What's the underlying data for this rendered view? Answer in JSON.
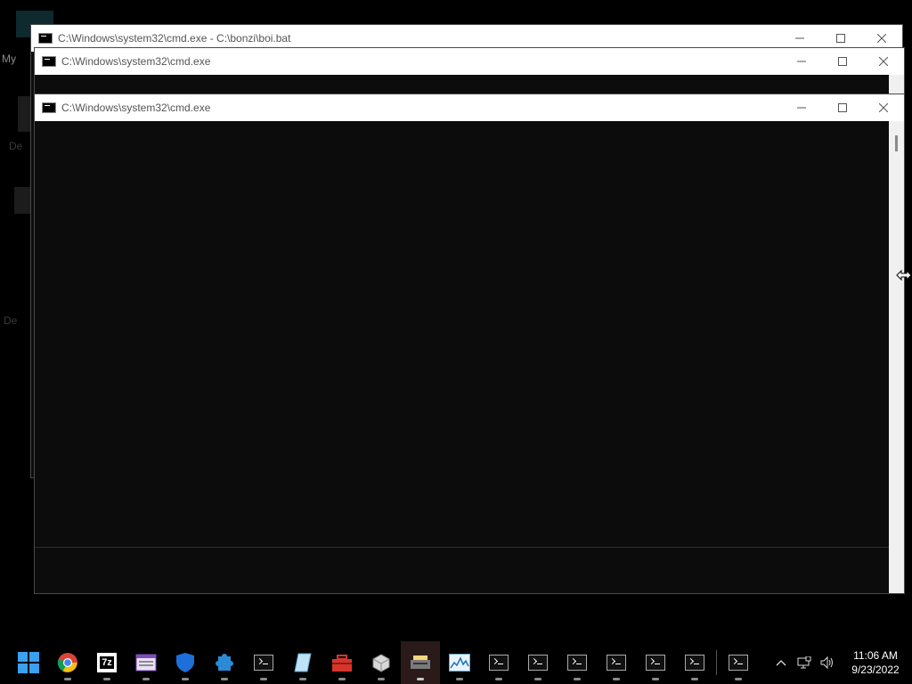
{
  "desktop": {
    "labels": [
      "My",
      "De",
      "De"
    ]
  },
  "windows": [
    {
      "title": "C:\\Windows\\system32\\cmd.exe - C:\\bonzi\\boi.bat",
      "state": "inactive"
    },
    {
      "title": "C:\\Windows\\system32\\cmd.exe",
      "state": "inactive"
    },
    {
      "title": "C:\\Windows\\system32\\cmd.exe",
      "state": "active"
    }
  ],
  "taskbar": {
    "items": [
      {
        "name": "start-button",
        "icon": "windows-logo-icon"
      },
      {
        "name": "chrome",
        "icon": "chrome-icon"
      },
      {
        "name": "7zip",
        "icon": "7zip-icon",
        "label": "7z"
      },
      {
        "name": "file-explorer",
        "icon": "files-icon"
      },
      {
        "name": "windows-security",
        "icon": "shield-icon"
      },
      {
        "name": "app-blue",
        "icon": "puzzle-icon"
      },
      {
        "name": "cmd-1",
        "icon": "terminal-icon"
      },
      {
        "name": "notepad",
        "icon": "notepad-icon"
      },
      {
        "name": "toolbox",
        "icon": "toolbox-icon"
      },
      {
        "name": "3d-viewer",
        "icon": "cube-icon"
      },
      {
        "name": "scanner",
        "icon": "scanner-icon",
        "active": true
      },
      {
        "name": "resource-monitor",
        "icon": "graph-icon"
      },
      {
        "name": "cmd-2",
        "icon": "terminal-icon"
      },
      {
        "name": "cmd-3",
        "icon": "terminal-icon"
      },
      {
        "name": "cmd-4",
        "icon": "terminal-icon"
      },
      {
        "name": "cmd-5",
        "icon": "terminal-icon"
      },
      {
        "name": "cmd-6",
        "icon": "terminal-icon"
      },
      {
        "name": "cmd-7",
        "icon": "terminal-icon"
      },
      {
        "name": "cmd-8",
        "icon": "terminal-icon"
      }
    ],
    "tray": {
      "time": "11:06 AM",
      "date": "9/23/2022"
    }
  },
  "colors": {
    "console_bg": "#0c0c0c",
    "titlebar_bg": "#ffffff",
    "taskbar_bg": "#000000",
    "windows_blue": "#1e90ff"
  }
}
